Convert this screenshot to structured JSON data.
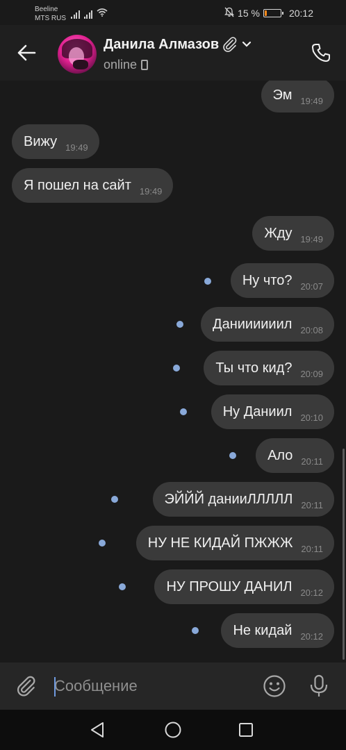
{
  "status_bar": {
    "carrier_1": "Beeline",
    "carrier_2": "MTS RUS",
    "battery_text": "15 %",
    "battery_level": 0.15,
    "battery_color": "#ff8a1a",
    "time": "20:12",
    "icons": [
      "signal-icon",
      "signal-icon",
      "wifi-icon",
      "mute-icon",
      "battery-icon"
    ]
  },
  "header": {
    "contact_name": "Данила Алмазов",
    "status": "online",
    "icons": [
      "back-arrow-icon",
      "paperclip-icon",
      "chevron-down-icon",
      "mobile-device-icon",
      "phone-call-icon"
    ]
  },
  "messages": [
    {
      "text": "Эм",
      "time": "19:49",
      "outgoing": true,
      "unread": false
    },
    {
      "text": "Вижу",
      "time": "19:49",
      "outgoing": false,
      "unread": false
    },
    {
      "text": "Я пошел на сайт",
      "time": "19:49",
      "outgoing": false,
      "unread": false
    },
    {
      "text": "Жду",
      "time": "19:49",
      "outgoing": true,
      "unread": false
    },
    {
      "text": "Ну что?",
      "time": "20:07",
      "outgoing": true,
      "unread": true
    },
    {
      "text": "Даниииииил",
      "time": "20:08",
      "outgoing": true,
      "unread": true
    },
    {
      "text": "Ты что кид?",
      "time": "20:09",
      "outgoing": true,
      "unread": true
    },
    {
      "text": "Ну Даниил",
      "time": "20:10",
      "outgoing": true,
      "unread": true
    },
    {
      "text": "Ало",
      "time": "20:11",
      "outgoing": true,
      "unread": true
    },
    {
      "text": "ЭЙЙЙ дании",
      "text_extra": "ЛЛЛЛЛ",
      "time": "20:11",
      "outgoing": true,
      "unread": true
    },
    {
      "text": "НУ НЕ КИДАЙ ПЖЖЖ",
      "time": "20:11",
      "outgoing": true,
      "unread": true
    },
    {
      "text": "НУ ПРОШУ ДАНИЛ",
      "time": "20:12",
      "outgoing": true,
      "unread": true
    },
    {
      "text": "Не кидай",
      "time": "20:12",
      "outgoing": true,
      "unread": true
    }
  ],
  "composer": {
    "placeholder": "Сообщение",
    "icons": [
      "paperclip-icon",
      "emoji-icon",
      "microphone-icon"
    ]
  },
  "colors": {
    "background": "#1a1a1a",
    "bubble": "#3a3a3a",
    "unread_dot": "#89a9d9",
    "accent": "#6f9be0"
  }
}
